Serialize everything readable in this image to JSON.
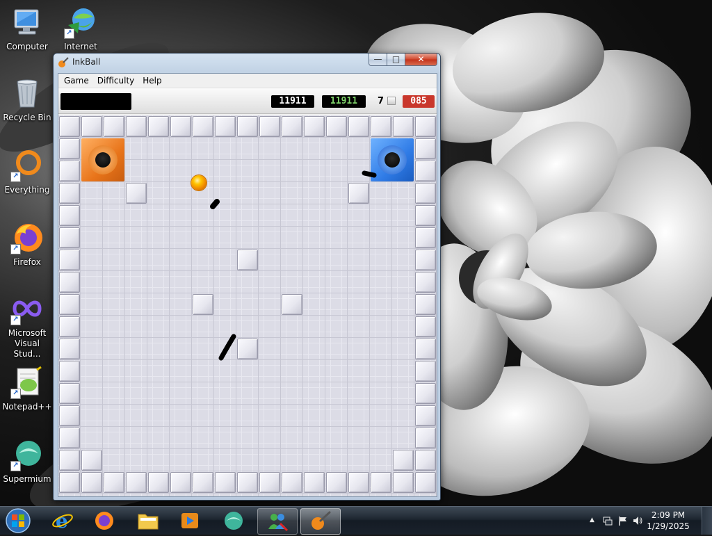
{
  "desktop": {
    "icons": [
      {
        "label": "Computer",
        "icon": "computer-icon",
        "shortcut": false
      },
      {
        "label": "Internet",
        "icon": "internet-download-manager-icon",
        "shortcut": true
      },
      {
        "label": "Recycle Bin",
        "icon": "recycle-bin-icon",
        "shortcut": false
      },
      {
        "label": "Everything",
        "icon": "everything-search-icon",
        "shortcut": true
      },
      {
        "label": "Firefox",
        "icon": "firefox-icon",
        "shortcut": true
      },
      {
        "label": "Microsoft Visual Stud...",
        "icon": "visual-studio-icon",
        "shortcut": true
      },
      {
        "label": "Notepad++",
        "icon": "notepad-plus-plus-icon",
        "shortcut": true
      },
      {
        "label": "Supermium",
        "icon": "supermium-icon",
        "shortcut": true
      }
    ]
  },
  "window": {
    "title": "InkBall",
    "menu": [
      "Game",
      "Difficulty",
      "Help"
    ],
    "caption_buttons": {
      "minimize": "—",
      "maximize": "□",
      "close": "✕"
    }
  },
  "scorebar": {
    "message": "",
    "current_score": "11911",
    "high_score": "11911",
    "balls_remaining": "7",
    "timer": "085"
  },
  "board": {
    "holes": [
      {
        "color": "orange",
        "hex": "#f07c1e"
      },
      {
        "color": "blue",
        "hex": "#2f7be6"
      }
    ],
    "ball": {
      "color": "gold",
      "hex": "#ffc400"
    },
    "ink_color": "#000000",
    "wall_color": "#e8e8f0"
  },
  "taskbar": {
    "apps": [
      {
        "name": "Internet Explorer",
        "icon": "internet-explorer-icon"
      },
      {
        "name": "Firefox",
        "icon": "firefox-icon"
      },
      {
        "name": "Windows Explorer",
        "icon": "folder-icon"
      },
      {
        "name": "Media Player",
        "icon": "media-player-icon"
      },
      {
        "name": "Supermium",
        "icon": "supermium-icon"
      },
      {
        "name": "Windows Live Messenger",
        "icon": "messenger-icon"
      },
      {
        "name": "InkBall",
        "icon": "inkball-icon"
      }
    ],
    "tray": {
      "chevron": "▲",
      "time": "2:09 PM",
      "date": "1/29/2025"
    }
  }
}
